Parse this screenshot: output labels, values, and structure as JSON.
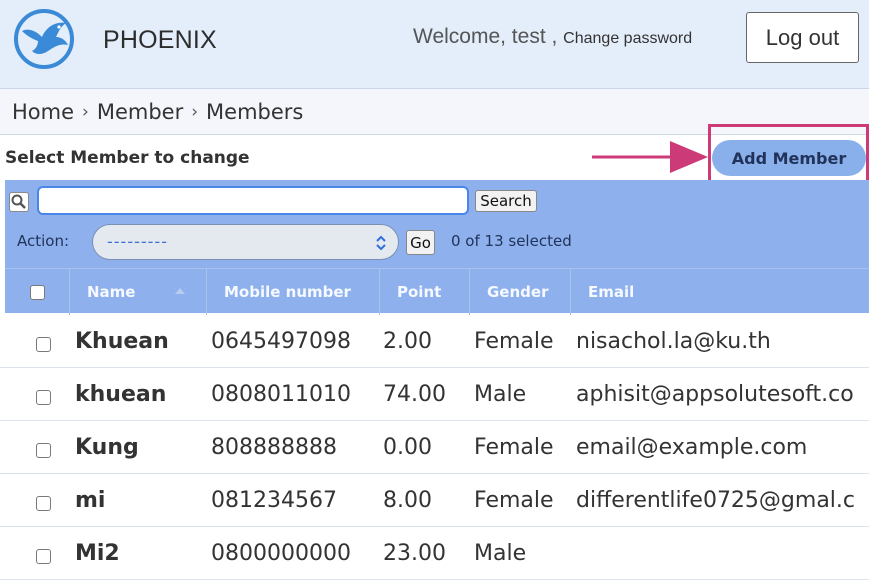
{
  "header": {
    "brand": "PHOENIX",
    "welcome_text": "Welcome, test ,",
    "change_password": "Change password",
    "logout": "Log out"
  },
  "breadcrumb": {
    "items": [
      "Home",
      "Member",
      "Members"
    ],
    "separator": "›"
  },
  "page": {
    "title": "Select Member to change",
    "add_button": "Add Member"
  },
  "toolbar": {
    "search_value": "",
    "search_button": "Search",
    "action_label": "Action:",
    "action_selected": "---------",
    "go_button": "Go",
    "selected_count": "0 of 13 selected"
  },
  "table": {
    "headers": [
      "Name",
      "Mobile number",
      "Point",
      "Gender",
      "Email"
    ],
    "rows": [
      {
        "name": "Khuean",
        "mobile": "0645497098",
        "point": "2.00",
        "gender": "Female",
        "email": "nisachol.la@ku.th"
      },
      {
        "name": "khuean",
        "mobile": "0808011010",
        "point": "74.00",
        "gender": "Male",
        "email": "aphisit@appsolutesoft.co"
      },
      {
        "name": "Kung",
        "mobile": "808888888",
        "point": "0.00",
        "gender": "Female",
        "email": "email@example.com"
      },
      {
        "name": "mi",
        "mobile": "081234567",
        "point": "8.00",
        "gender": "Female",
        "email": "differentlife0725@gmal.c"
      },
      {
        "name": "Mi2",
        "mobile": "0800000000",
        "point": "23.00",
        "gender": "Male",
        "email": ""
      }
    ]
  },
  "colors": {
    "header_bg": "#e4edfa",
    "toolbar_bg": "#8eb1ee",
    "add_button_bg": "#8ab0ec",
    "highlight": "#cc3a78"
  }
}
